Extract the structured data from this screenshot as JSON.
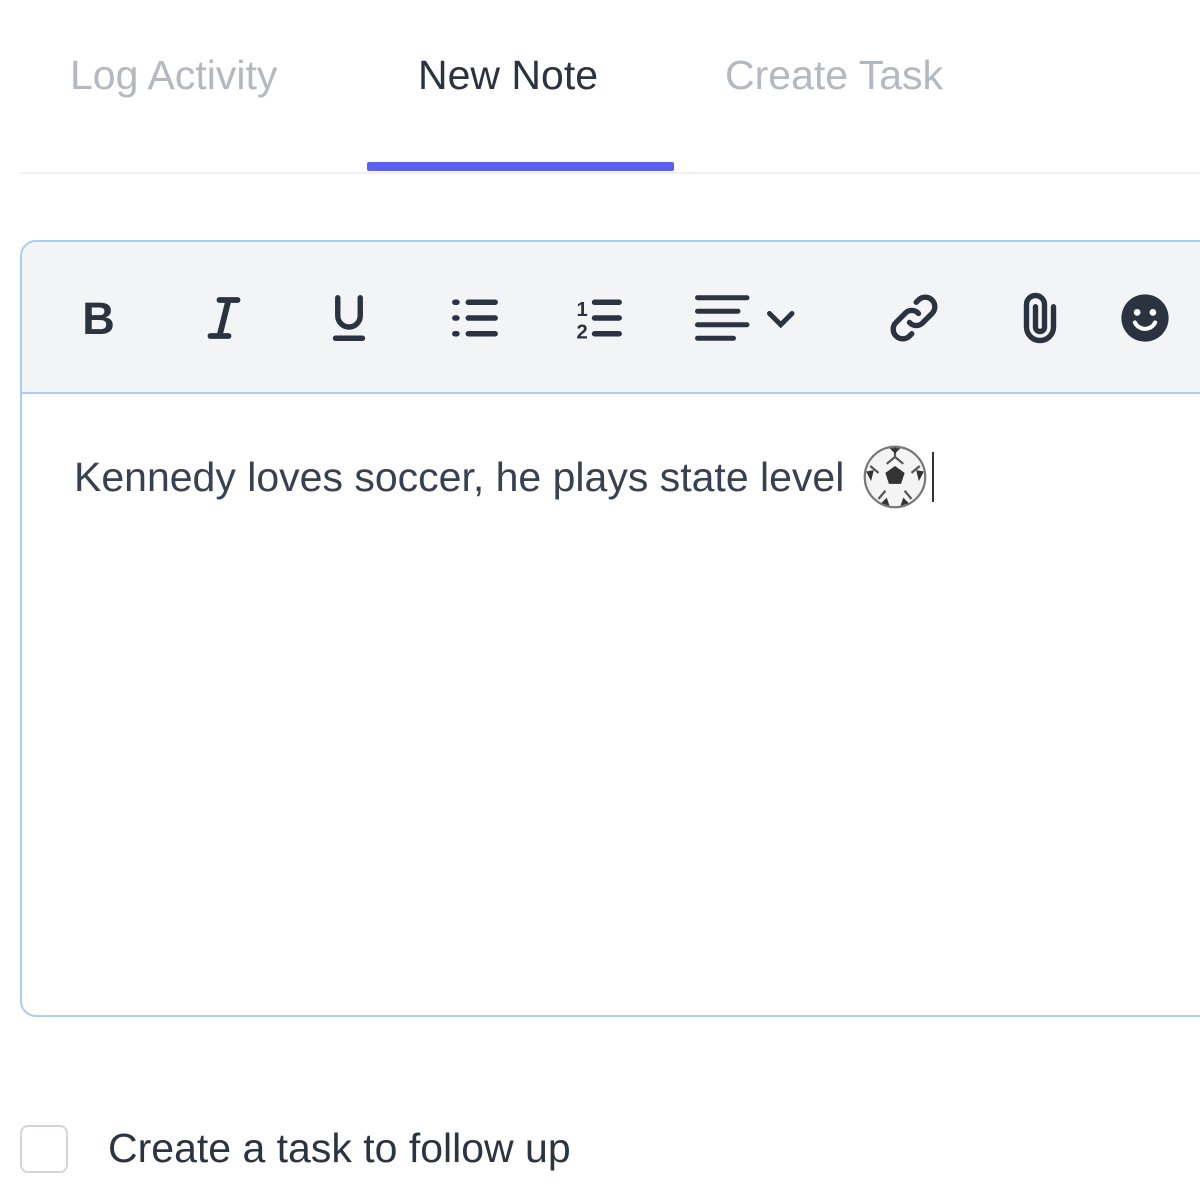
{
  "tabs": [
    {
      "label": "Log Activity",
      "active": false
    },
    {
      "label": "New Note",
      "active": true
    },
    {
      "label": "Create Task",
      "active": false
    }
  ],
  "toolbar": {
    "buttons": [
      "bold-icon",
      "italic-icon",
      "underline-icon",
      "bullet-list-icon",
      "numbered-list-icon",
      "align-left-icon",
      "link-icon",
      "paperclip-icon",
      "emoji-icon"
    ]
  },
  "editor": {
    "text": "Kennedy loves soccer, he plays state level",
    "emoji": "soccer-ball-icon"
  },
  "followup": {
    "label": "Create a task to follow up",
    "checked": false
  },
  "colors": {
    "accent": "#5b5ff2",
    "focus_border": "#a9cdf7",
    "toolbar_bg": "#f3f4f6"
  }
}
